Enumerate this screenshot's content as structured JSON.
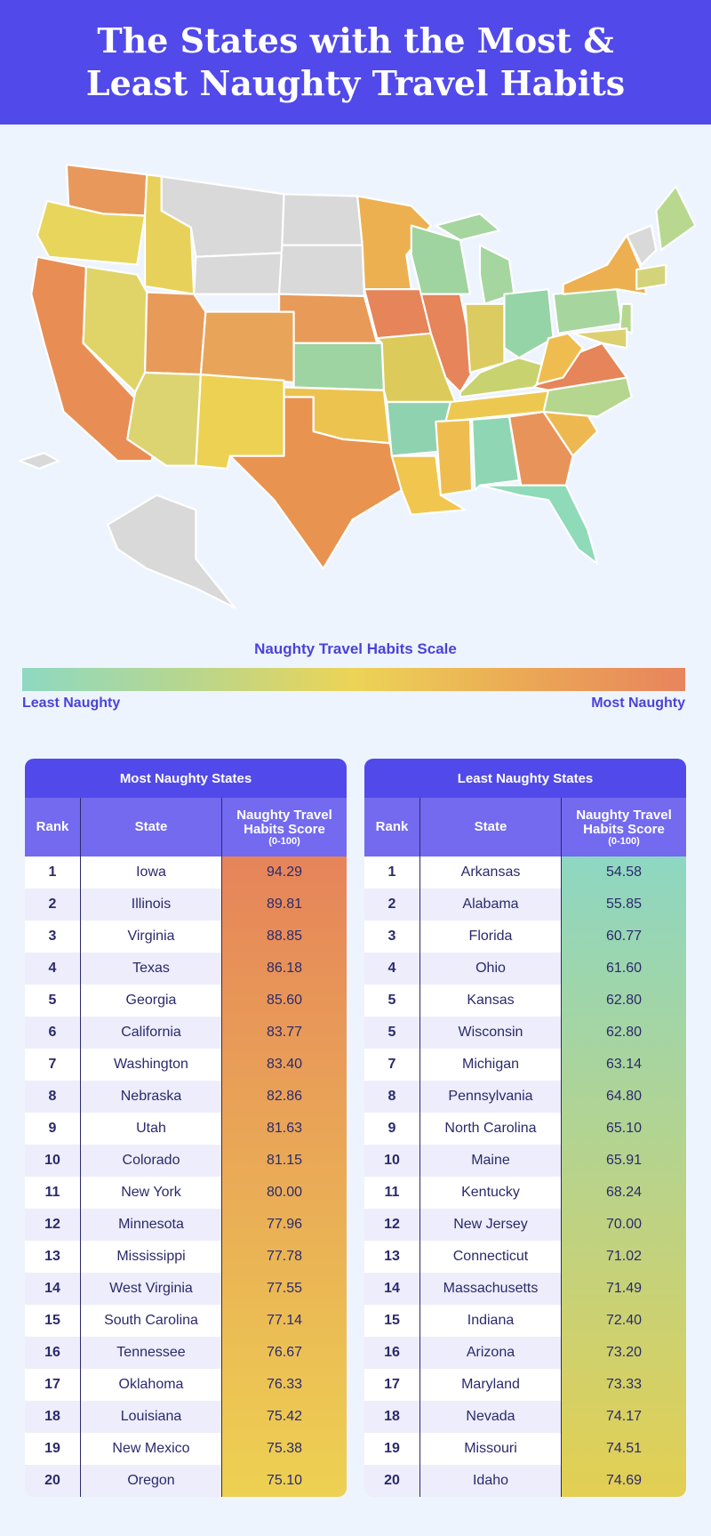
{
  "title": "The States with the Most & Least Naughty Travel Habits",
  "scale": {
    "title": "Naughty Travel Habits Scale",
    "low_label": "Least Naughty",
    "high_label": "Most Naughty",
    "colors": [
      "#8ed9c2",
      "#ecd456",
      "#e8845d"
    ]
  },
  "map": {
    "no_data_color": "#d9d9d9",
    "state_colors": {
      "WA": "#e8985a",
      "OR": "#e8d55c",
      "CA": "#e88e55",
      "ID": "#e8d15a",
      "NV": "#e0d468",
      "MT": "#d9d9d9",
      "WY": "#d9d9d9",
      "UT": "#e89a58",
      "CO": "#e8a55a",
      "AZ": "#dcd470",
      "NM": "#edd153",
      "ND": "#d9d9d9",
      "SD": "#d9d9d9",
      "NE": "#e89a58",
      "KS": "#9ed3a2",
      "OK": "#edc350",
      "TX": "#e8934f",
      "MN": "#edb050",
      "IA": "#e6845a",
      "MO": "#dccb5a",
      "AR": "#8fd2b0",
      "LA": "#f0c64f",
      "WI": "#9fd4a0",
      "IL": "#e6845a",
      "MI": "#a5d69f",
      "IN": "#dccb60",
      "OH": "#95d4a6",
      "KY": "#c8d370",
      "TN": "#edc850",
      "MS": "#efbd4f",
      "AL": "#8fd6b4",
      "GA": "#e8935a",
      "FL": "#8fdab8",
      "SC": "#eeb850",
      "NC": "#b5d68e",
      "VA": "#e6845a",
      "WV": "#efbd4f",
      "PA": "#a6d69d",
      "NY": "#edb050",
      "NJ": "#b5d68e",
      "MD": "#dcd070",
      "ME": "#b8d890",
      "NH": "#d9d9d9",
      "MA": "#d3d37a",
      "AK": "#d9d9d9",
      "HI": "#d9d9d9"
    }
  },
  "chart_data": [
    {
      "type": "table",
      "title": "Most Naughty States",
      "columns": [
        "Rank",
        "State",
        "Naughty Travel Habits Score",
        "(0-100)"
      ],
      "gradient": [
        "#e6845a",
        "#edd152"
      ],
      "rows": [
        [
          "1",
          "Iowa",
          "94.29"
        ],
        [
          "2",
          "Illinois",
          "89.81"
        ],
        [
          "3",
          "Virginia",
          "88.85"
        ],
        [
          "4",
          "Texas",
          "86.18"
        ],
        [
          "5",
          "Georgia",
          "85.60"
        ],
        [
          "6",
          "California",
          "83.77"
        ],
        [
          "7",
          "Washington",
          "83.40"
        ],
        [
          "8",
          "Nebraska",
          "82.86"
        ],
        [
          "9",
          "Utah",
          "81.63"
        ],
        [
          "10",
          "Colorado",
          "81.15"
        ],
        [
          "11",
          "New York",
          "80.00"
        ],
        [
          "12",
          "Minnesota",
          "77.96"
        ],
        [
          "13",
          "Mississippi",
          "77.78"
        ],
        [
          "14",
          "West Virginia",
          "77.55"
        ],
        [
          "15",
          "South Carolina",
          "77.14"
        ],
        [
          "16",
          "Tennessee",
          "76.67"
        ],
        [
          "17",
          "Oklahoma",
          "76.33"
        ],
        [
          "18",
          "Louisiana",
          "75.42"
        ],
        [
          "19",
          "New Mexico",
          "75.38"
        ],
        [
          "20",
          "Oregon",
          "75.10"
        ]
      ]
    },
    {
      "type": "table",
      "title": "Least Naughty States",
      "columns": [
        "Rank",
        "State",
        "Naughty Travel Habits Score",
        "(0-100)"
      ],
      "gradient": [
        "#8dd7c2",
        "#e3cf52"
      ],
      "rows": [
        [
          "1",
          "Arkansas",
          "54.58"
        ],
        [
          "2",
          "Alabama",
          "55.85"
        ],
        [
          "3",
          "Florida",
          "60.77"
        ],
        [
          "4",
          "Ohio",
          "61.60"
        ],
        [
          "5",
          "Kansas",
          "62.80"
        ],
        [
          "5",
          "Wisconsin",
          "62.80"
        ],
        [
          "7",
          "Michigan",
          "63.14"
        ],
        [
          "8",
          "Pennsylvania",
          "64.80"
        ],
        [
          "9",
          "North Carolina",
          "65.10"
        ],
        [
          "10",
          "Maine",
          "65.91"
        ],
        [
          "11",
          "Kentucky",
          "68.24"
        ],
        [
          "12",
          "New Jersey",
          "70.00"
        ],
        [
          "13",
          "Connecticut",
          "71.02"
        ],
        [
          "14",
          "Massachusetts",
          "71.49"
        ],
        [
          "15",
          "Indiana",
          "72.40"
        ],
        [
          "16",
          "Arizona",
          "73.20"
        ],
        [
          "17",
          "Maryland",
          "73.33"
        ],
        [
          "18",
          "Nevada",
          "74.17"
        ],
        [
          "19",
          "Missouri",
          "74.51"
        ],
        [
          "20",
          "Idaho",
          "74.69"
        ]
      ]
    }
  ]
}
